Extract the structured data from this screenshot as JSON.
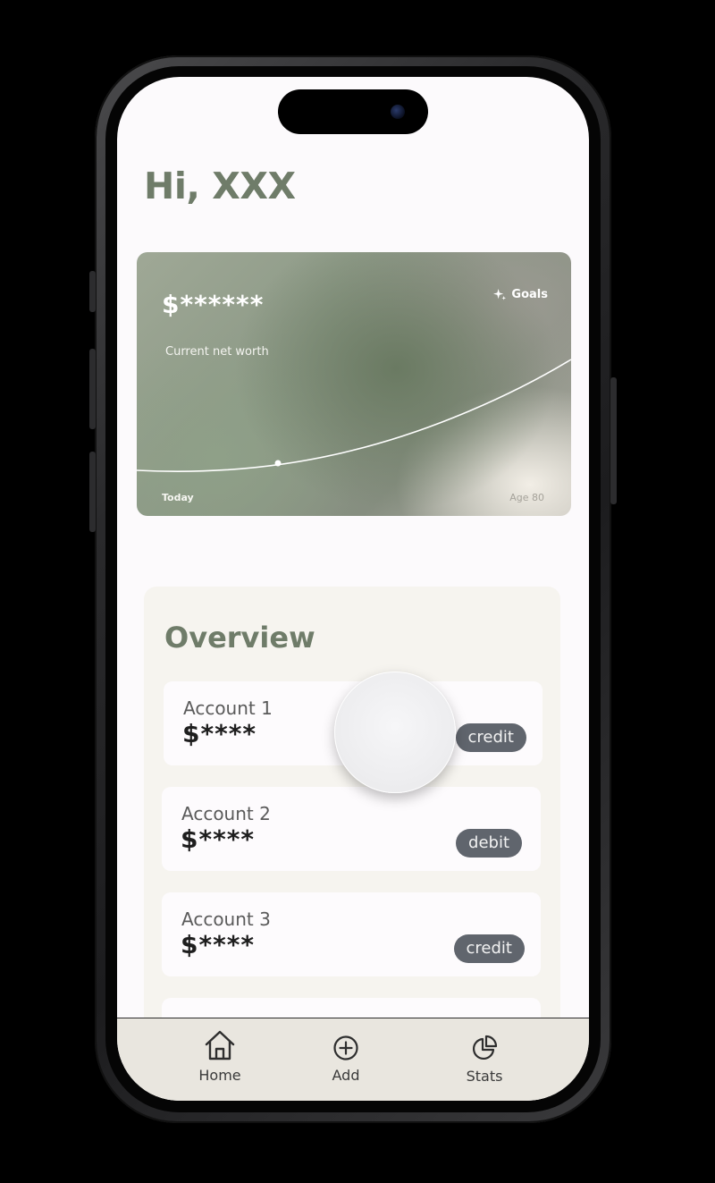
{
  "greeting": "Hi, XXX",
  "networth": {
    "amount": "$******",
    "label": "Current net worth",
    "goals_label": "Goals",
    "start_label": "Today",
    "end_label": "Age 80"
  },
  "overview": {
    "title": "Overview",
    "accounts": [
      {
        "name": "Account 1",
        "balance": "$****",
        "type": "credit"
      },
      {
        "name": "Account 2",
        "balance": "$****",
        "type": "debit"
      },
      {
        "name": "Account 3",
        "balance": "$****",
        "type": "credit"
      }
    ]
  },
  "tab_bar": {
    "items": [
      {
        "label": "Home",
        "icon": "home-icon"
      },
      {
        "label": "Add",
        "icon": "plus-circle-icon"
      },
      {
        "label": "Stats",
        "icon": "pie-chart-icon"
      }
    ]
  },
  "colors": {
    "accent_green": "#6f7c69",
    "badge_gray": "#60656d",
    "tab_bar_bg": "#e9e6df"
  }
}
